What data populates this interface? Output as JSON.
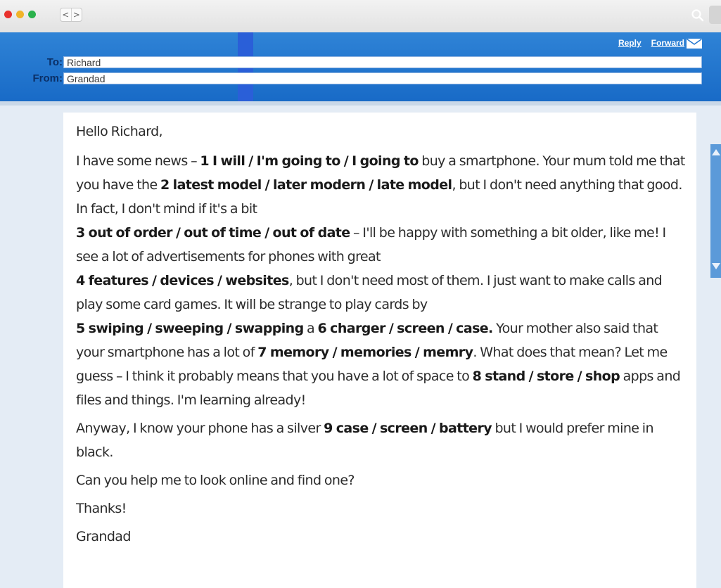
{
  "window": {
    "nav_back": "<",
    "nav_forward": ">",
    "search_icon": "search-icon"
  },
  "email": {
    "actions": {
      "reply": "Reply",
      "forward": "Forward"
    },
    "to_label": "To:",
    "to_value": "Richard",
    "from_label": "From:",
    "from_value": "Grandad"
  },
  "letter": {
    "greeting": "Hello Richard,",
    "p1": {
      "t1": "I have some news – ",
      "g1": "1 I will / I'm going to / I going to",
      "t2": " buy a smartphone. Your mum told me that you have the ",
      "g2": "2 latest model / later modern / late model",
      "t3": ", but I don't need anything that good. In fact, I don't mind if it's a bit ",
      "g3": "3 out of order / out of time / out of date",
      "t4": " – I'll be happy with something a bit older, like me! I see a lot of advertisements for phones with great ",
      "g4": "4 features / devices / websites",
      "t5": ", but I don't need most of them. I just want to make calls and play some card games. It will be strange to play cards by ",
      "g5": "5 swiping / sweeping / swapping",
      "t6": " a ",
      "g6": "6 charger / screen / case.",
      "t7": " Your mother also said that your smartphone has a lot of ",
      "g7": "7 memory / memories / memry",
      "t8": ". What does that mean? Let me guess – I think it probably means that you have a lot of space to ",
      "g8": "8 stand / store / shop",
      "t9": " apps and files and things. I'm learning already!"
    },
    "p2": {
      "t1": "Anyway, I know your phone has a silver ",
      "g9": "9 case / screen / battery",
      "t2": " but I would prefer mine in black."
    },
    "p3": "Can you help me to look online and find one?",
    "p4": "Thanks!",
    "p5": "Grandad"
  },
  "colors": {
    "header_blue": "#1f74cf",
    "body_bg": "#e4ecf5",
    "label_navy": "#0b2f66"
  }
}
